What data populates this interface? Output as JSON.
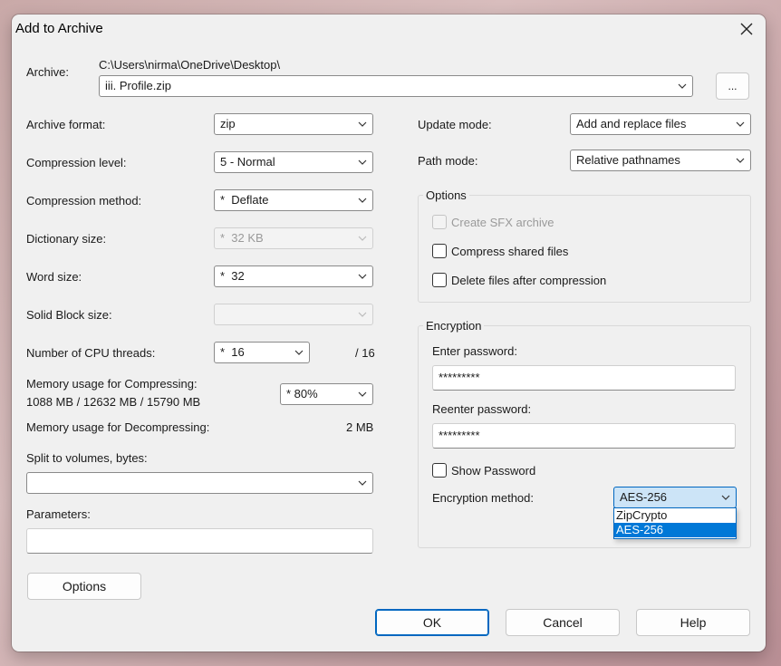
{
  "dialog": {
    "title": "Add to Archive"
  },
  "archive": {
    "label": "Archive:",
    "path": "C:\\Users\\nirma\\OneDrive\\Desktop\\",
    "filename": "iii. Profile.zip",
    "browse_label": "..."
  },
  "left": {
    "format": {
      "label": "Archive format:",
      "value": "zip"
    },
    "level": {
      "label": "Compression level:",
      "value": "5 - Normal"
    },
    "method": {
      "label": "Compression method:",
      "value": "*  Deflate"
    },
    "dict": {
      "label": "Dictionary size:",
      "value": "*  32 KB"
    },
    "word": {
      "label": "Word size:",
      "value": "*  32"
    },
    "solid": {
      "label": "Solid Block size:",
      "value": ""
    },
    "threads": {
      "label": "Number of CPU threads:",
      "value": "*  16",
      "max": "/ 16"
    },
    "mem_comp": {
      "label": "Memory usage for Compressing:",
      "detail": "1088 MB / 12632 MB / 15790 MB",
      "value": "* 80%"
    },
    "mem_decomp": {
      "label": "Memory usage for Decompressing:",
      "value": "2 MB"
    },
    "split": {
      "label": "Split to volumes, bytes:",
      "value": ""
    },
    "params": {
      "label": "Parameters:",
      "value": ""
    },
    "options_button": "Options"
  },
  "right": {
    "update": {
      "label": "Update mode:",
      "value": "Add and replace files"
    },
    "path_mode": {
      "label": "Path mode:",
      "value": "Relative pathnames"
    },
    "options_group": {
      "title": "Options",
      "sfx": "Create SFX archive",
      "shared": "Compress shared files",
      "delete": "Delete files after compression"
    },
    "encryption": {
      "title": "Encryption",
      "enter_label": "Enter password:",
      "enter_value": "*********",
      "reenter_label": "Reenter password:",
      "reenter_value": "*********",
      "show_password": "Show Password",
      "method_label": "Encryption method:",
      "method_value": "AES-256",
      "method_options": [
        "ZipCrypto",
        "AES-256"
      ]
    }
  },
  "footer": {
    "ok": "OK",
    "cancel": "Cancel",
    "help": "Help"
  },
  "colors": {
    "accent": "#0067c0",
    "selection": "#0078d7",
    "dialog_bg": "#f0f0f0"
  }
}
